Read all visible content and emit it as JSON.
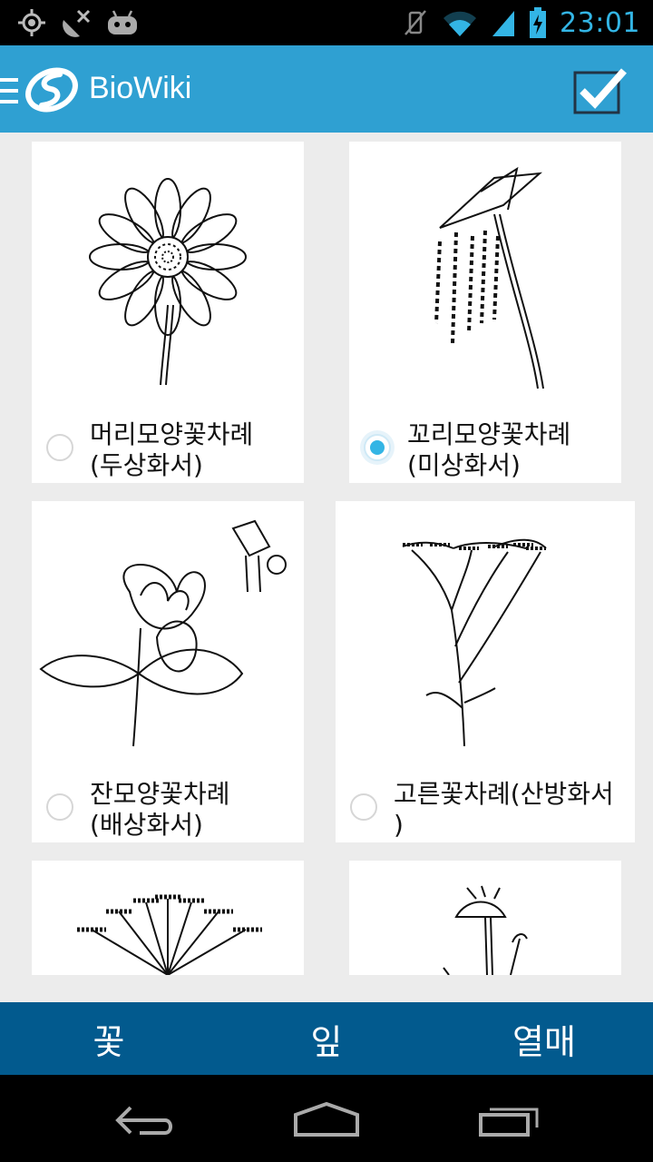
{
  "status_bar": {
    "time": "23:01",
    "left_icons": [
      "location-icon",
      "satellite-icon",
      "android-debug-icon"
    ],
    "right_icons": [
      "mute-icon",
      "wifi-icon",
      "signal-icon",
      "battery-charging-icon"
    ]
  },
  "app_bar": {
    "title": "BioWiki",
    "accent_color": "#2fa0d2",
    "icons": [
      "menu-icon",
      "biowiki-logo-icon",
      "checkbox-checked-icon"
    ]
  },
  "grid": {
    "items": [
      {
        "label": "머리모양꽃차례\n(두상화서)",
        "selected": false,
        "icon": "flower-head-illustration"
      },
      {
        "label": "꼬리모양꽃차례\n(미상화서)",
        "selected": true,
        "icon": "catkin-illustration"
      },
      {
        "label": "잔모양꽃차례\n(배상화서)",
        "selected": false,
        "icon": "cyathium-illustration"
      },
      {
        "label": "고른꽃차례(산방화서\n)",
        "selected": false,
        "icon": "corymb-illustration"
      },
      {
        "label": "",
        "selected": false,
        "icon": "umbel-illustration"
      },
      {
        "label": "",
        "selected": false,
        "icon": "daisy-illustration"
      }
    ]
  },
  "tabs": [
    {
      "label": "꽃"
    },
    {
      "label": "잎"
    },
    {
      "label": "열매"
    }
  ],
  "tab_bar_color": "#025a8e",
  "nav_bar": {
    "icons": [
      "back-icon",
      "home-icon",
      "recent-apps-icon"
    ]
  }
}
